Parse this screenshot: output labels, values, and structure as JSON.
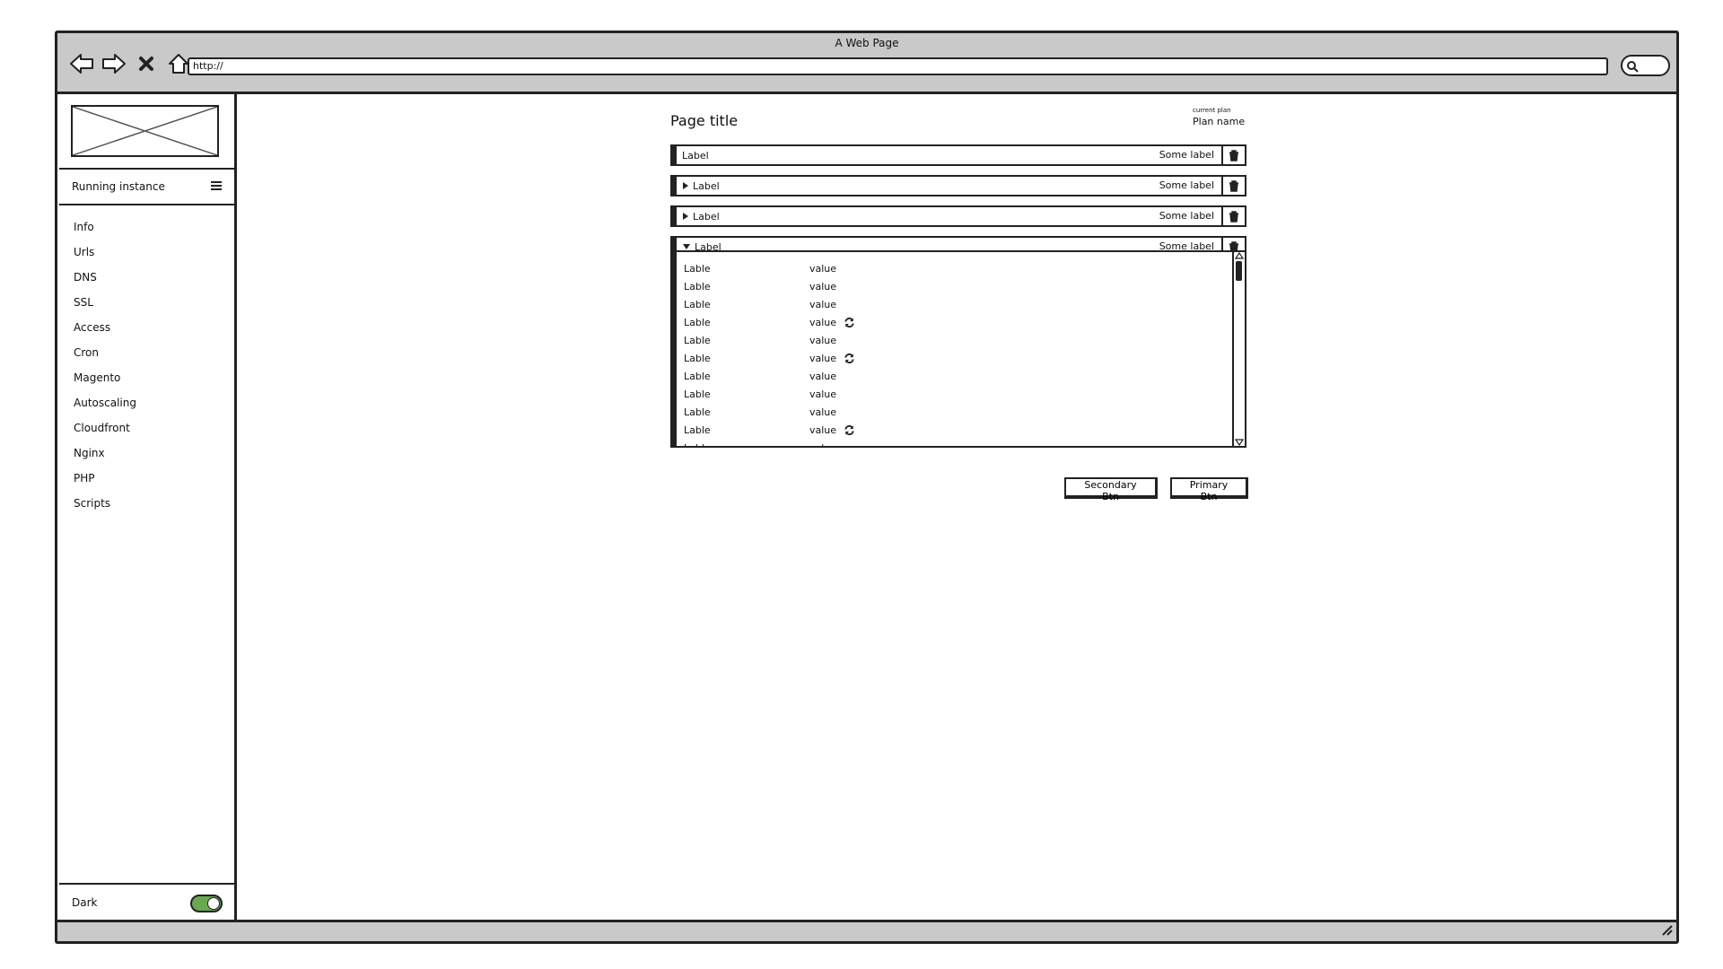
{
  "window": {
    "title": "A Web Page",
    "url": "http://"
  },
  "sidebar": {
    "instance_label": "Running instance",
    "items": [
      "Info",
      "Urls",
      "DNS",
      "SSL",
      "Access",
      "Cron",
      "Magento",
      "Autoscaling",
      "Cloudfront",
      "Nginx",
      "PHP",
      "Scripts"
    ],
    "theme_label": "Dark",
    "theme_toggle_on": true
  },
  "main": {
    "page_title": "Page title",
    "plan_caption": "current plan",
    "plan_name": "Plan name",
    "accordion": [
      {
        "label": "Label",
        "right_label": "Some label",
        "state": "none"
      },
      {
        "label": "Label",
        "right_label": "Some label",
        "state": "collapsed"
      },
      {
        "label": "Label",
        "right_label": "Some label",
        "state": "collapsed"
      },
      {
        "label": "Label",
        "right_label": "Some label",
        "state": "expanded"
      }
    ],
    "rows": [
      {
        "label": "Lable",
        "value": "value",
        "refresh": false
      },
      {
        "label": "Lable",
        "value": "value",
        "refresh": false
      },
      {
        "label": "Lable",
        "value": "value",
        "refresh": false
      },
      {
        "label": "Lable",
        "value": "value",
        "refresh": true
      },
      {
        "label": "Lable",
        "value": "value",
        "refresh": false
      },
      {
        "label": "Lable",
        "value": "value",
        "refresh": true
      },
      {
        "label": "Lable",
        "value": "value",
        "refresh": false
      },
      {
        "label": "Lable",
        "value": "value",
        "refresh": false
      },
      {
        "label": "Lable",
        "value": "value",
        "refresh": false
      },
      {
        "label": "Lable",
        "value": "value",
        "refresh": true
      },
      {
        "label": "Lable",
        "value": "value",
        "refresh": false
      }
    ],
    "secondary_btn": "Secondary Btn",
    "primary_btn": "Primary Btn"
  },
  "colors": {
    "frame": "#c9c9c9",
    "ink": "#222222",
    "toggle_on": "#6aa84f"
  },
  "icons": [
    "back-icon",
    "forward-icon",
    "close-icon",
    "home-icon",
    "search-icon",
    "hamburger-icon",
    "trash-icon",
    "refresh-icon",
    "triangle-right-icon",
    "triangle-down-icon",
    "resize-grip-icon"
  ]
}
